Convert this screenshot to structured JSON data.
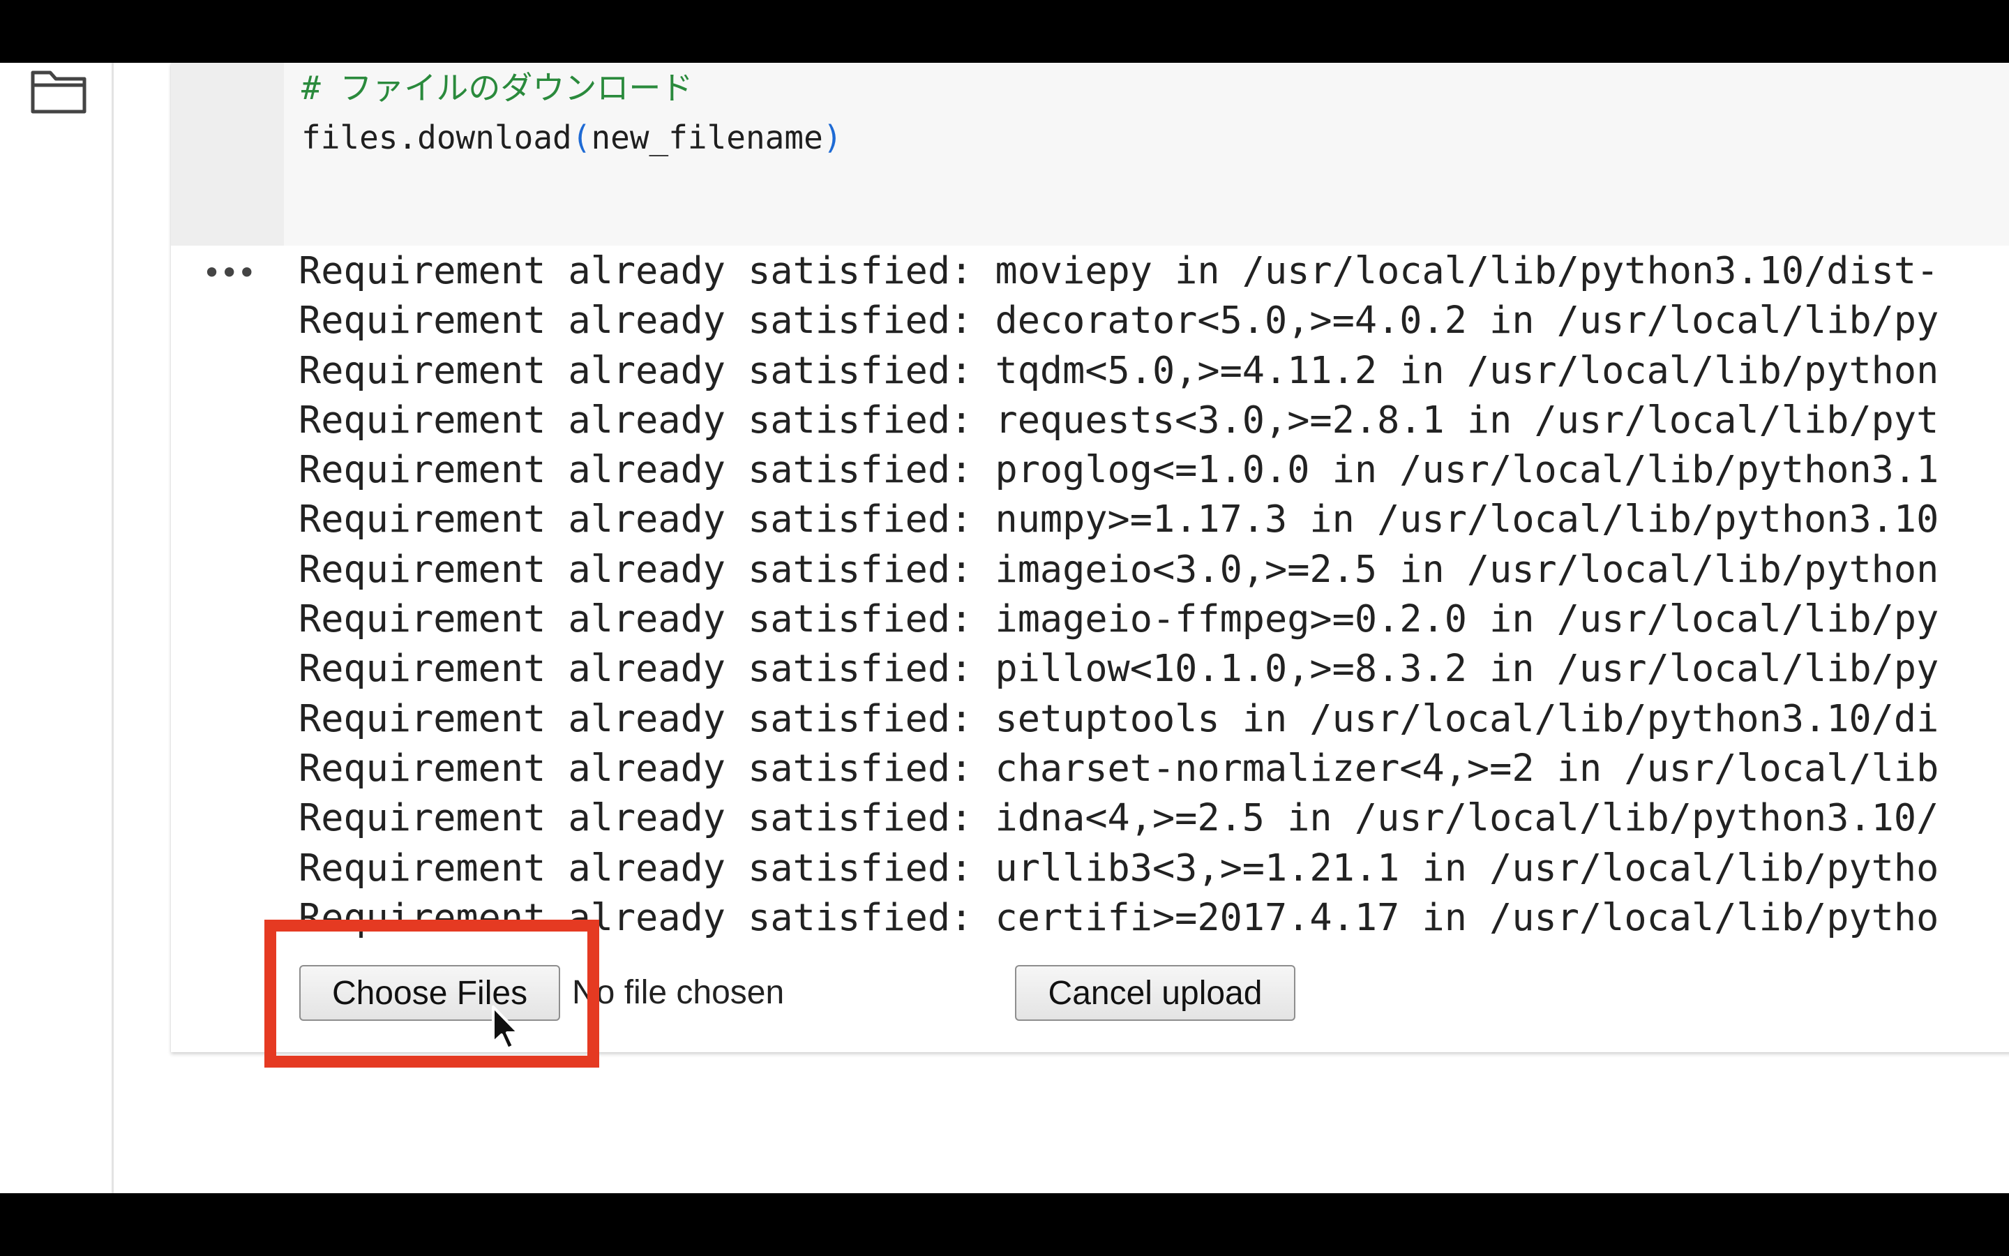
{
  "code": {
    "comment": "# ファイルのダウンロード",
    "call_name": "files.download",
    "paren_open": "(",
    "call_arg": "new_filename",
    "paren_close": ")"
  },
  "output": {
    "menu_icon": "ellipsis-icon",
    "lines": [
      "Requirement already satisfied: moviepy in /usr/local/lib/python3.10/dist-",
      "Requirement already satisfied: decorator<5.0,>=4.0.2 in /usr/local/lib/py",
      "Requirement already satisfied: tqdm<5.0,>=4.11.2 in /usr/local/lib/python",
      "Requirement already satisfied: requests<3.0,>=2.8.1 in /usr/local/lib/pyt",
      "Requirement already satisfied: proglog<=1.0.0 in /usr/local/lib/python3.1",
      "Requirement already satisfied: numpy>=1.17.3 in /usr/local/lib/python3.10",
      "Requirement already satisfied: imageio<3.0,>=2.5 in /usr/local/lib/python",
      "Requirement already satisfied: imageio-ffmpeg>=0.2.0 in /usr/local/lib/py",
      "Requirement already satisfied: pillow<10.1.0,>=8.3.2 in /usr/local/lib/py",
      "Requirement already satisfied: setuptools in /usr/local/lib/python3.10/di",
      "Requirement already satisfied: charset-normalizer<4,>=2 in /usr/local/lib",
      "Requirement already satisfied: idna<4,>=2.5 in /usr/local/lib/python3.10/",
      "Requirement already satisfied: urllib3<3,>=1.21.1 in /usr/local/lib/pytho",
      "Requirement already satisfied: certifi>=2017.4.17 in /usr/local/lib/pytho"
    ]
  },
  "upload": {
    "choose_label": "Choose Files",
    "no_file_text": "No file chosen",
    "cancel_label": "Cancel upload"
  },
  "sidebar": {
    "icon": "folder-icon"
  },
  "colors": {
    "highlight": "#e53a22",
    "comment": "#2a8a3c",
    "paren": "#1e6ad4"
  }
}
